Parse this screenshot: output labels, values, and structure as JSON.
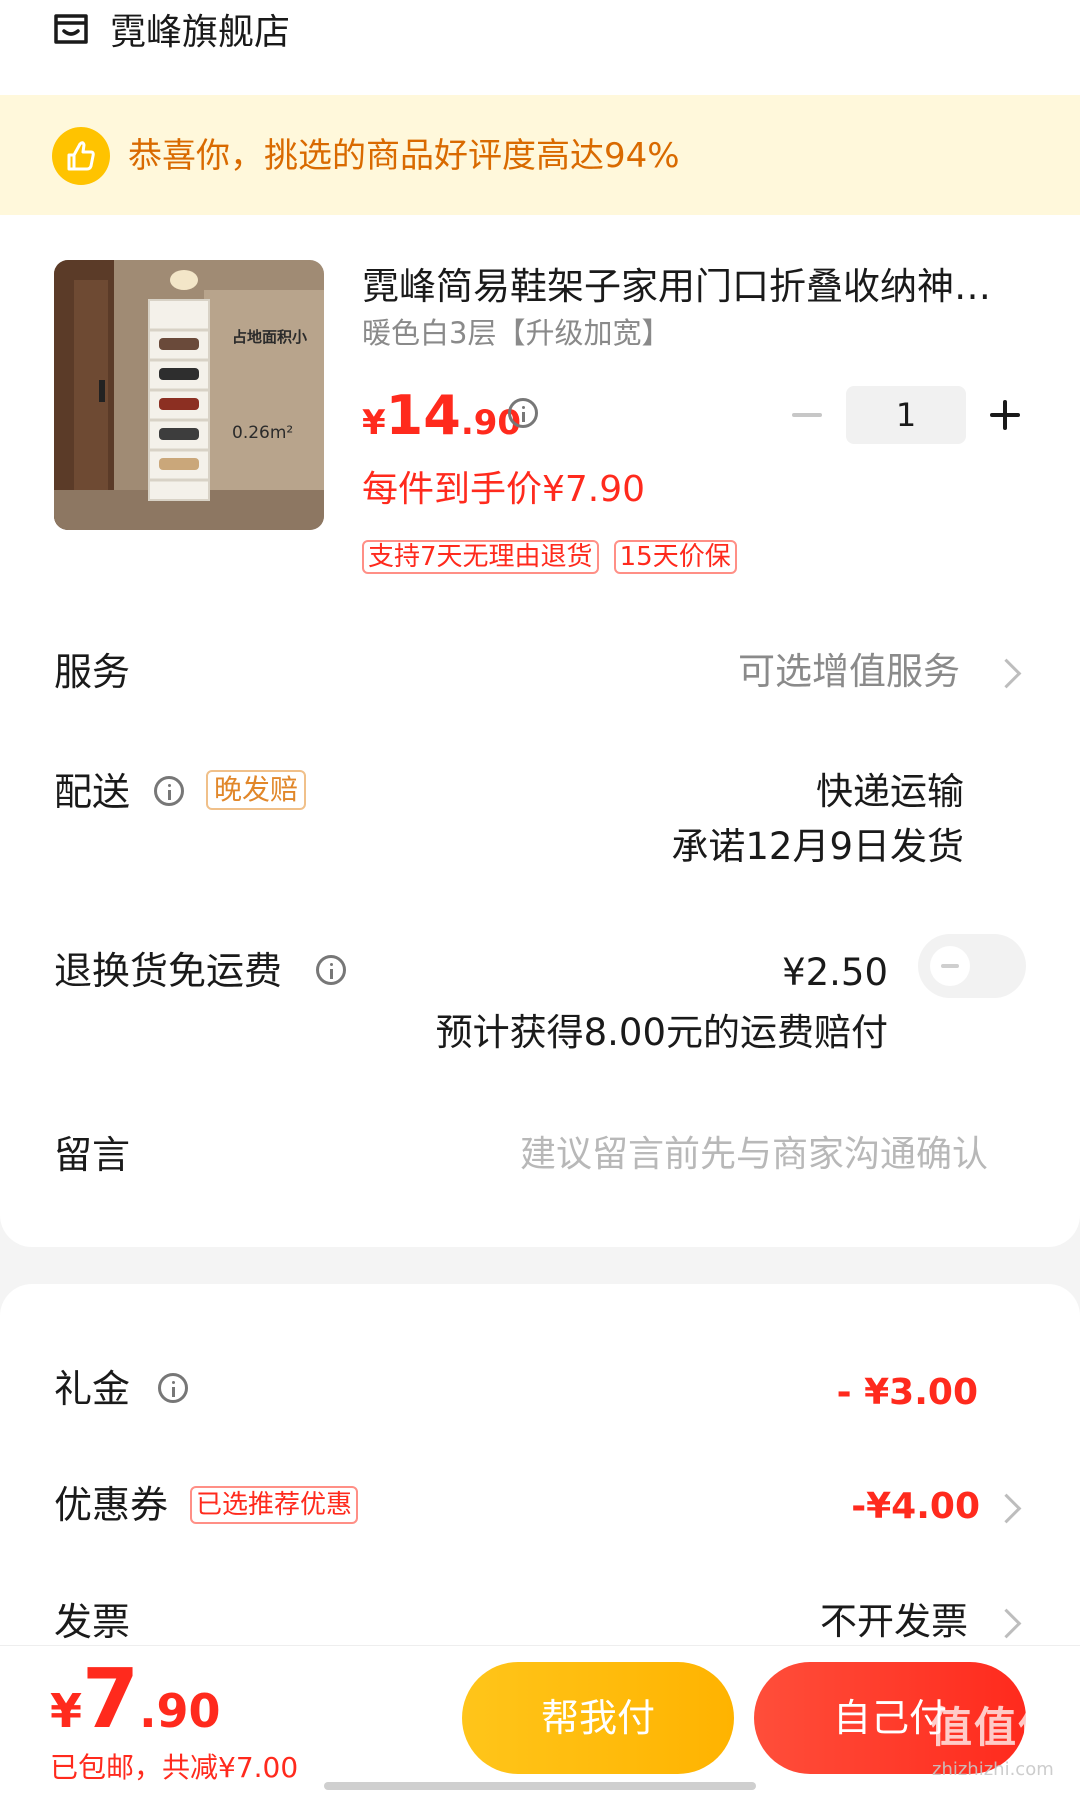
{
  "store": {
    "name": "霓峰旗舰店",
    "icon": "store-icon"
  },
  "congrats": {
    "text": "恭喜你，挑选的商品好评度高达94%",
    "icon": "thumbs-up-icon"
  },
  "product": {
    "title": "霓峰简易鞋架子家用门口折叠收纳神…",
    "spec": "暖色白3层【升级加宽】",
    "image_text_1": "占地面积小",
    "image_text_2": "0.26m²",
    "price": {
      "currency": "¥",
      "integer": "14",
      "decimal": ".90"
    },
    "unit_price": "每件到手价¥7.90",
    "quantity": "1",
    "tags": [
      "支持7天无理由退货",
      "15天价保"
    ]
  },
  "rows": {
    "service": {
      "label": "服务",
      "value": "可选增值服务"
    },
    "delivery": {
      "label": "配送",
      "tag": "晚发赔",
      "method": "快递运输",
      "promise": "承诺12月9日发货"
    },
    "return_shipping": {
      "label": "退换货免运费",
      "price": "¥2.50",
      "note": "预计获得8.00元的运费赔付",
      "toggle_on": false
    },
    "message": {
      "label": "留言",
      "placeholder": "建议留言前先与商家沟通确认"
    }
  },
  "discounts": {
    "gift": {
      "label": "礼金",
      "value": "- ¥3.00"
    },
    "coupon": {
      "label": "优惠券",
      "tag": "已选推荐优惠",
      "value": "-¥4.00"
    },
    "invoice": {
      "label": "发票",
      "value": "不开发票"
    }
  },
  "footer": {
    "total": {
      "currency": "¥",
      "integer": "7",
      "decimal": ".90"
    },
    "note": "已包邮，共减¥7.00",
    "help_pay": "帮我付",
    "self_pay": "自己付"
  },
  "watermark": {
    "text": "值值值",
    "url": "zhizhizhi.com"
  },
  "colors": {
    "accent": "#ff2a1d",
    "help_button": "#ffb300",
    "congrats_bg": "#fff8db",
    "congrats_text": "#d96a00"
  }
}
